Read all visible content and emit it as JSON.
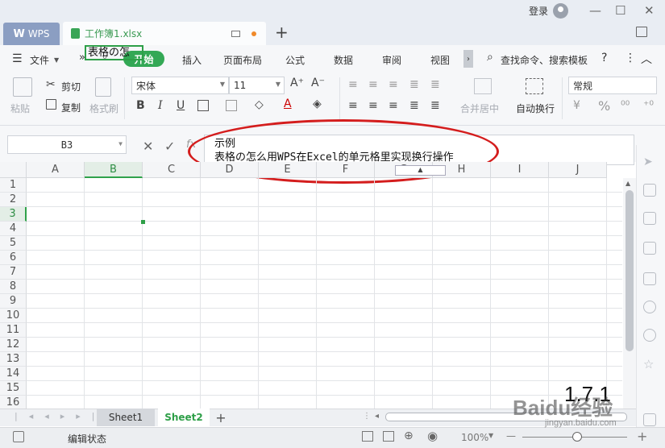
{
  "title_bar": {
    "wps_tab_label": "WPS",
    "doc_tab_label": "工作簿1.xlsx",
    "new_tab_symbol": "+",
    "login_label": "登录",
    "minimize_symbol": "—",
    "maximize_symbol": "☐",
    "close_symbol": "✕"
  },
  "menu": {
    "file_label": "文件",
    "more_symbol": "»",
    "dropdown_symbol": "▿",
    "tabs": [
      "开始",
      "插入",
      "页面布局",
      "公式",
      "数据",
      "审阅",
      "视图"
    ],
    "active_tab": "开始",
    "search_label": "查找命令、搜索模板",
    "help_symbol": "?",
    "overflow_symbol": "⋮",
    "collapse_symbol": "︿"
  },
  "toolbar": {
    "paste_label": "粘贴",
    "cut_label": "剪切",
    "copy_label": "复制",
    "format_painter_label": "格式刷",
    "font_name": "宋体",
    "font_size": "11",
    "grow_font": "A⁺",
    "shrink_font": "A⁻",
    "bold": "B",
    "italic": "I",
    "underline": "U",
    "font_color_letter": "A",
    "merge_label": "合并居中",
    "wrap_label": "自动换行",
    "number_format": "常规",
    "percent_symbol": "%"
  },
  "formula_bar": {
    "cell_ref": "B3",
    "cancel_symbol": "✕",
    "confirm_symbol": "✓",
    "fx_symbol": "fx",
    "line1": "示例",
    "line2": "表格の怎么用WPS在Excel的单元格里实现换行操作"
  },
  "grid": {
    "columns": [
      "A",
      "B",
      "C",
      "D",
      "E",
      "F",
      "G",
      "H",
      "I",
      "J"
    ],
    "rows": [
      "1",
      "2",
      "3",
      "4",
      "5",
      "6",
      "7",
      "8",
      "9",
      "10",
      "11",
      "12",
      "13",
      "14",
      "15",
      "16"
    ],
    "selected_column": "B",
    "selected_row": "3",
    "selected_cell_text": "表格の怎"
  },
  "sheets": {
    "tabs": [
      "Sheet1",
      "Sheet2"
    ],
    "active": "Sheet2",
    "add_symbol": "+",
    "nav": [
      "|<",
      "<",
      ">",
      ">|"
    ]
  },
  "status_bar": {
    "mode": "编辑状态",
    "zoom": "100%",
    "zoom_out": "—",
    "zoom_in": "+"
  },
  "watermark": {
    "number": "1.7.1",
    "brand": "Baidu经验",
    "url": "jingyan.baidu.com"
  },
  "colors": {
    "accent_green": "#33a855",
    "annotation_red": "#d41d1d",
    "wps_tab": "#8b9ec2"
  }
}
